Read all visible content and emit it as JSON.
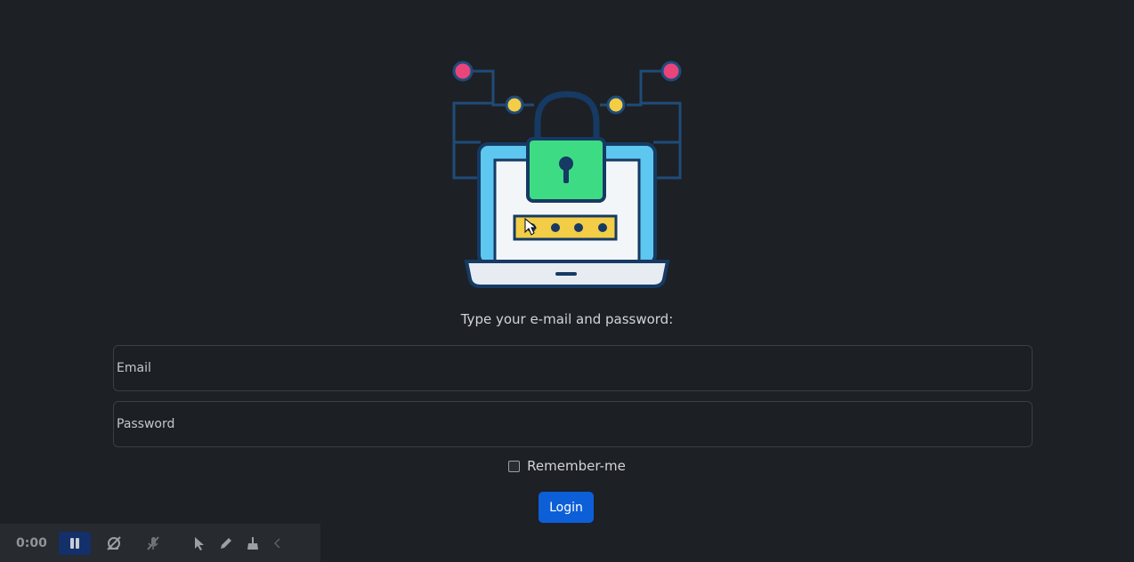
{
  "login": {
    "prompt": "Type your e-mail and password:",
    "email_placeholder": "Email",
    "password_placeholder": "Password",
    "remember_label": "Remember-me",
    "login_label": "Login"
  },
  "recorder": {
    "time": "0:00"
  },
  "colors": {
    "background": "#1d2024",
    "primary_button": "#0d5fd8",
    "lock_green": "#3ddc84",
    "circuit_pink": "#e8457a",
    "circuit_yellow": "#f2cd45",
    "screen_blue": "#5ec7f0"
  },
  "icons": [
    "security-laptop-illustration",
    "pause-icon",
    "camera-off-icon",
    "mic-off-icon",
    "pointer-icon",
    "pen-icon",
    "broom-icon",
    "chevron-left-icon"
  ]
}
